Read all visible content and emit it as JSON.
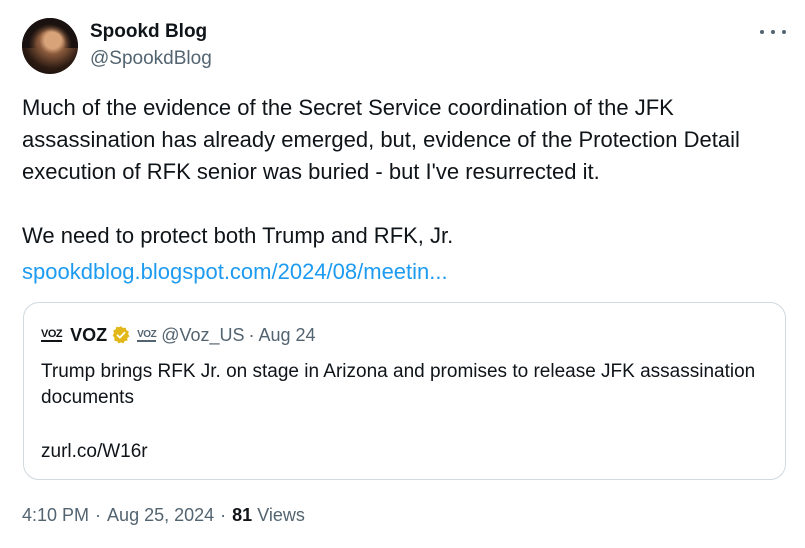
{
  "author": {
    "name": "Spookd Blog",
    "handle": "@SpookdBlog"
  },
  "tweet": {
    "text": "Much of the evidence of the Secret Service coordination of the JFK assassination has already emerged, but, evidence of the Protection Detail execution of RFK senior was buried - but I've resurrected it.\n\nWe need to protect both Trump and RFK, Jr.",
    "link_text": "spookdblog.blogspot.com/2024/08/meetin..."
  },
  "quote": {
    "logo_text": "VOZ",
    "name": "VOZ",
    "badge_logo_text": "VOZ",
    "handle": "@Voz_US",
    "separator": "·",
    "date": "Aug 24",
    "text": "Trump brings RFK Jr. on stage in Arizona and promises to release JFK assassination documents",
    "url": "zurl.co/W16r"
  },
  "meta": {
    "time": "4:10 PM",
    "separator": "·",
    "date": "Aug 25, 2024",
    "separator2": "·",
    "views_count": "81",
    "views_label": "Views"
  },
  "colors": {
    "link": "#1d9bf0",
    "secondary_text": "#536471",
    "verified_gold": "#e2b719"
  },
  "icons": {
    "more": "more-horizontal-icon",
    "verified": "verified-badge-icon"
  }
}
